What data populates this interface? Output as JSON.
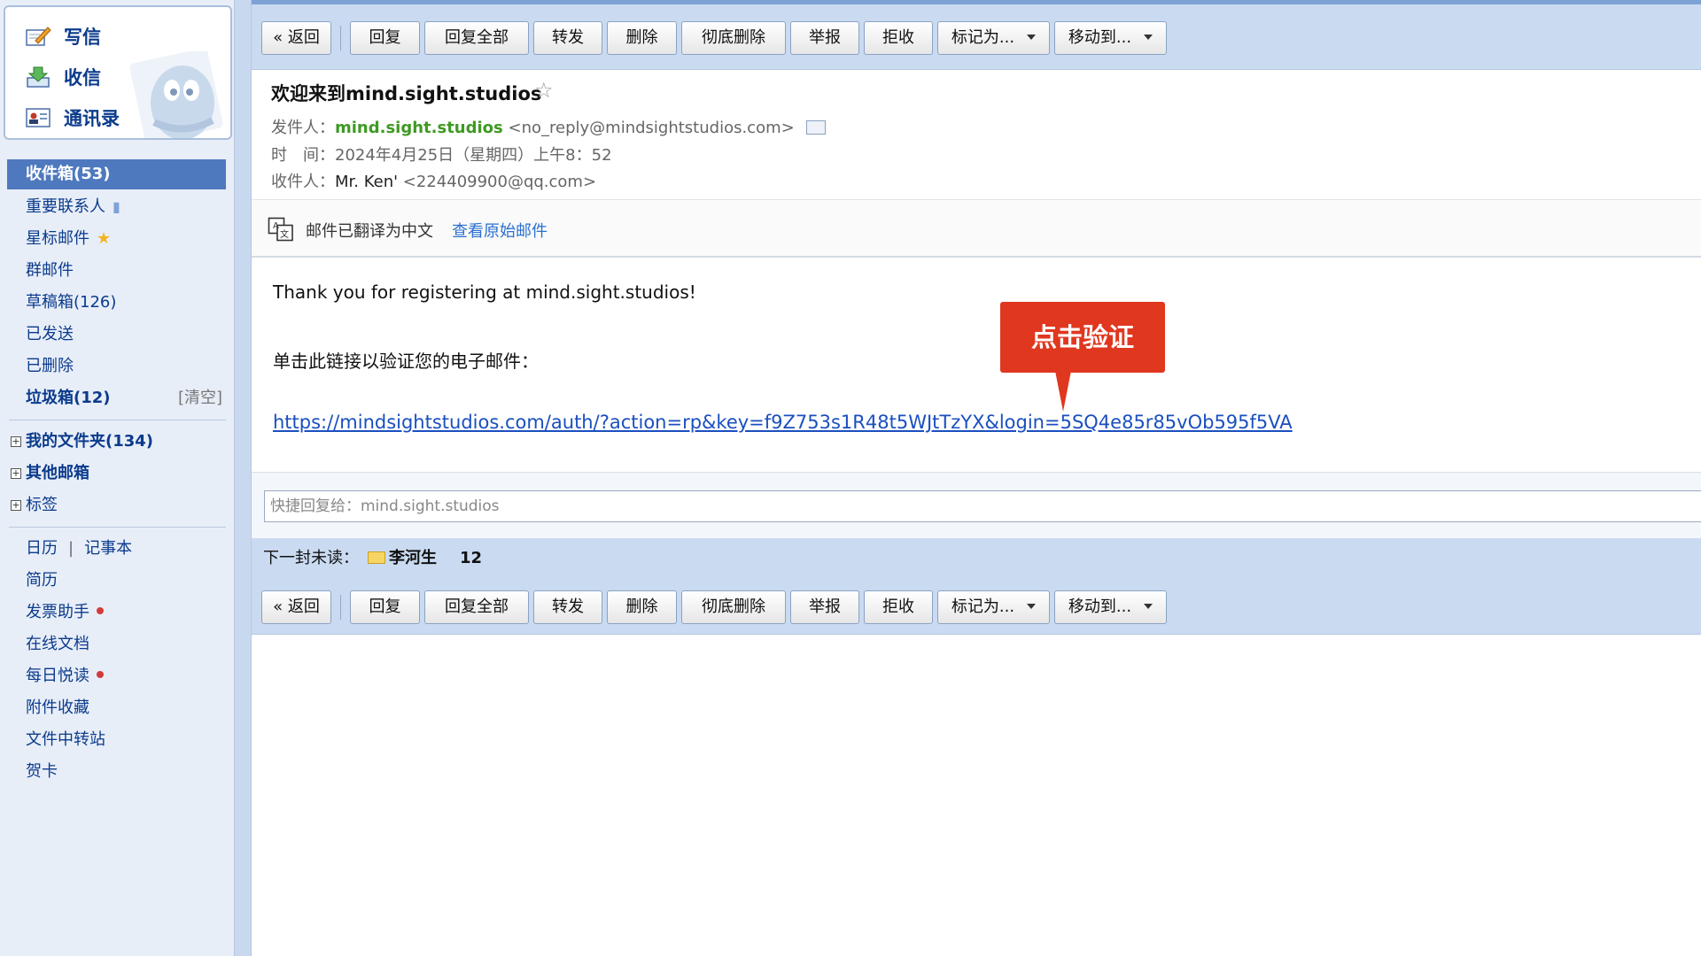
{
  "sidebar": {
    "top_actions": [
      {
        "label": "写信",
        "icon": "compose-icon"
      },
      {
        "label": "收信",
        "icon": "receive-icon"
      },
      {
        "label": "通讯录",
        "icon": "contacts-icon"
      }
    ],
    "folders": {
      "inbox": "收件箱(53)",
      "vip": "重要联系人",
      "starred": "星标邮件",
      "group": "群邮件",
      "drafts": "草稿箱(126)",
      "sent": "已发送",
      "deleted": "已删除",
      "spam": "垃圾箱(12)",
      "spam_clear": "[清空]"
    },
    "trees": {
      "my_folders": "我的文件夹(134)",
      "other_mailboxes": "其他邮箱",
      "tags": "标签"
    },
    "tools": {
      "calendar": "日历",
      "separator": "|",
      "notepad": "记事本",
      "resume": "简历",
      "invoice": "发票助手",
      "docs": "在线文档",
      "daily_read": "每日悦读",
      "attachments": "附件收藏",
      "file_transfer": "文件中转站",
      "card": "贺卡"
    }
  },
  "toolbar": {
    "back": "« 返回",
    "reply": "回复",
    "reply_all": "回复全部",
    "forward": "转发",
    "delete": "删除",
    "perm_delete": "彻底删除",
    "report": "举报",
    "reject": "拒收",
    "mark_as": "标记为...",
    "move_to": "移动到..."
  },
  "mail": {
    "subject": "欢迎来到mind.sight.studios",
    "from_label": "发件人：",
    "from_name": "mind.sight.studios",
    "from_email": "<no_reply@mindsightstudios.com>",
    "time_label": "时　间：",
    "time_value": "2024年4月25日（星期四）上午8：52",
    "to_label": "收件人：",
    "to_name": "Mr. Ken'",
    "to_email": "<224409900@qq.com>",
    "translated_notice": "邮件已翻译为中文",
    "view_original": "查看原始邮件",
    "body_thanks": "Thank you for registering at mind.sight.studios!",
    "body_instruction": "单击此链接以验证您的电子邮件：",
    "verify_url": "https://mindsightstudios.com/auth/?action=rp&key=f9Z753s1R48t5WJtTzYX&login=5SQ4e85r85vOb595f5VA"
  },
  "callout": {
    "text": "点击验证"
  },
  "quick_reply": {
    "placeholder": "快捷回复给：mind.sight.studios"
  },
  "next_unread": {
    "label": "下一封未读：",
    "sender": "李河生",
    "count": "12"
  },
  "colors": {
    "accent": "#4f79be",
    "toolbar_bg": "#c9daf1",
    "callout": "#e0371f",
    "sender_green": "#3e9a22",
    "link_blue": "#1a4fbf"
  }
}
